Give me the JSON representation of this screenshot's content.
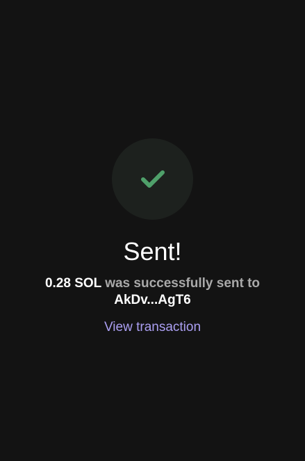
{
  "status": {
    "icon": "checkmark-icon",
    "title": "Sent!",
    "amount": "0.28 SOL",
    "message_middle": " was successfully sent to",
    "recipient": "AkDv...AgT6",
    "view_link_label": "View transaction"
  },
  "colors": {
    "background": "#131313",
    "circle": "#1d211e",
    "check": "#4fa06a",
    "accent": "#ab9ff2",
    "muted_text": "#a9a9a9",
    "text": "#ffffff"
  }
}
